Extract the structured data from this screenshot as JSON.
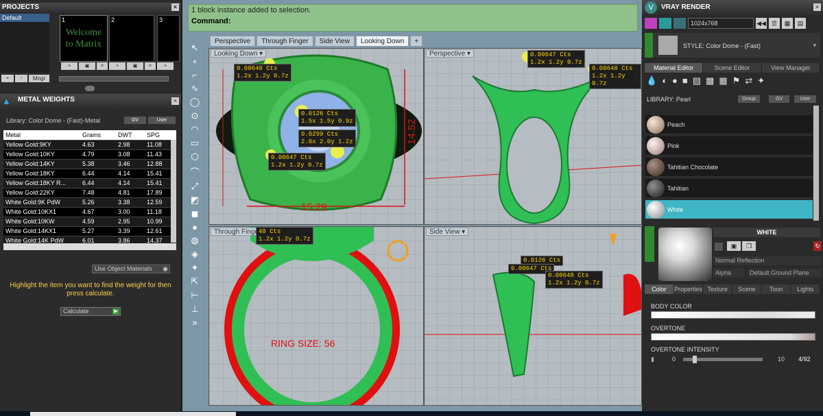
{
  "projects": {
    "title": "PROJECTS",
    "item": "Default",
    "slots": [
      "1",
      "2",
      "3"
    ],
    "welcome": "Welcome to Matrix",
    "mngr": "Mngr"
  },
  "metal": {
    "title": "METAL WEIGHTS",
    "library": "Library: Color Dome - (Fast)-Metal",
    "gv": "GV",
    "user": "User",
    "headers": [
      "Metal",
      "Grams",
      "DWT",
      "SPG"
    ],
    "rows": [
      [
        "Yellow Gold:9KY",
        "4.63",
        "2.98",
        "11.08"
      ],
      [
        "Yellow Gold:10KY",
        "4.79",
        "3.08",
        "11.43"
      ],
      [
        "Yellow Gold:14KY",
        "5.38",
        "3.46",
        "12.88"
      ],
      [
        "Yellow Gold:18KY",
        "6.44",
        "4.14",
        "15.41"
      ],
      [
        "Yellow Gold:18KY R...",
        "6.44",
        "4.14",
        "15.41"
      ],
      [
        "Yellow Gold:22KY",
        "7.48",
        "4.81",
        "17.89"
      ],
      [
        "White Gold:9K PdW",
        "5.26",
        "3.38",
        "12.59"
      ],
      [
        "White Gold:10KX1",
        "4.67",
        "3.00",
        "11.18"
      ],
      [
        "White Gold:10KW",
        "4.59",
        "2.95",
        "10.99"
      ],
      [
        "White Gold:14KX1",
        "5.27",
        "3.39",
        "12.61"
      ],
      [
        "White Gold:14K PdW",
        "6.01",
        "3.86",
        "14.37"
      ]
    ],
    "use_obj": "Use Object Materials",
    "hint": "Highlight the item you want to find the weight for then press calculate.",
    "calc": "Calculate"
  },
  "cmd": {
    "msg": "1 block instance added to selection.",
    "label": "Command:"
  },
  "tabs": [
    "Perspective",
    "Through Finger",
    "Side View",
    "Looking Down"
  ],
  "views": {
    "tl": "Looking Down",
    "tr": "Perspective",
    "bl": "Through Finger",
    "br": "Side View"
  },
  "dims": {
    "w": "15.29",
    "h": "14.52",
    "ring": "RING SIZE: 56"
  },
  "tags": {
    "a": "0.00648 Cts",
    "a2": "1.2x 1.2y 0.7z",
    "b": "0.0126 Cts",
    "b2": "1.5x 1.5y 0.9z",
    "c": "0.0299 Cts",
    "c2": "2.0x 2.0y 1.2z",
    "d": "0.00647 Cts",
    "d2": "1.2x 1.2y 0.7z",
    "e": "0.00647 Cts",
    "e2": "1.2x 1.2y 0.7z",
    "f": "0.00648 Cts",
    "f2": "1.2x 1.2y 0.7z",
    "g": "48 Cts",
    "g2": "1.2x 1.2y 0.7z",
    "h": "0.0126 Cts",
    "i": "0.00647 Cts",
    "j": "0.00648 Cts",
    "j2": "1.2x 1.2y 0.7z"
  },
  "vray": {
    "title": "VRAY RENDER",
    "res": "1024x768",
    "style": "STYLE: Color Dome - (Fast)",
    "tabs": [
      "Material Editor",
      "Scene Editor",
      "View Manager"
    ],
    "library": "LIBRARY: Pearl",
    "group": "Group",
    "gv": "GV",
    "user": "User",
    "materials": [
      "Peach",
      "Pink",
      "Tahitian Chocolate",
      "Tahitian",
      "White"
    ],
    "selected": "WHITE",
    "refl": "Normal Reflection",
    "alpha": "Alpha",
    "ground": "Default Ground Plane",
    "subtabs": [
      "Color",
      "Properties",
      "Texture",
      "Scene",
      "Toon",
      "Lights"
    ],
    "body": "BODY COLOR",
    "overtone": "OVERTONE",
    "intensity": "OVERTONE INTENSITY",
    "min": "0",
    "max": "10",
    "val": "4/92"
  },
  "colors": {
    "accent": "#3fb6c4",
    "green": "#2fbf55",
    "red": "#e01010"
  }
}
